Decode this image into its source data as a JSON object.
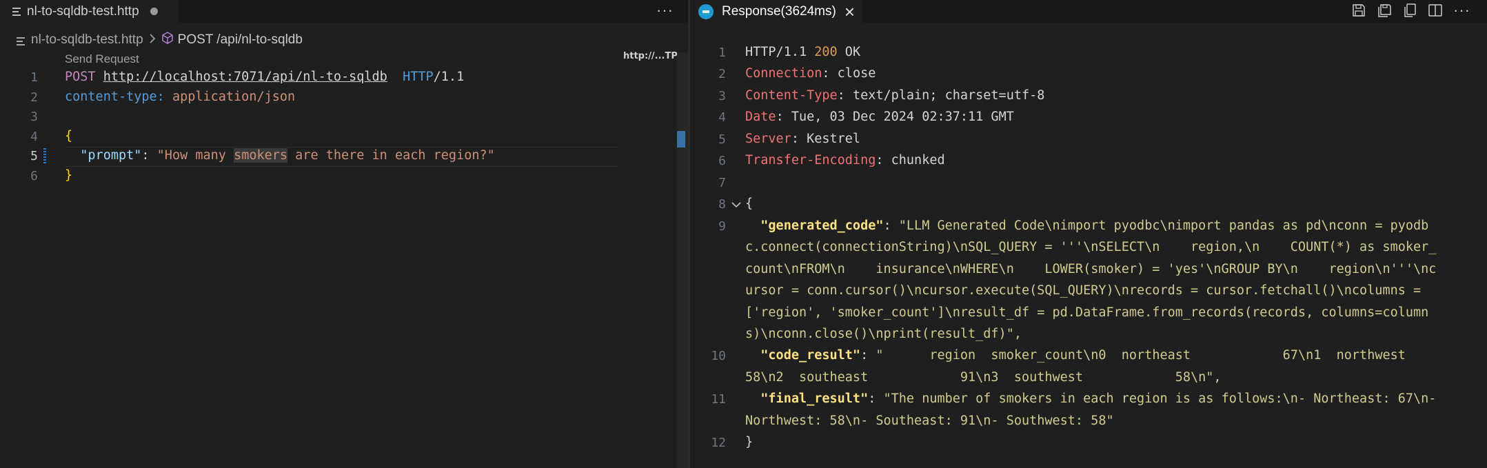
{
  "left": {
    "tab": {
      "title": "nl-to-sqldb-test.http"
    },
    "more_label": "···",
    "breadcrumb": {
      "file": "nl-to-sqldb-test.http",
      "request": "POST /api/nl-to-sqldb"
    },
    "codelens": "Send Request",
    "minimap_text": "http://...TP",
    "line_numbers": [
      "1",
      "2",
      "3",
      "4",
      "5",
      "6"
    ],
    "lines": {
      "l1": {
        "method": "POST",
        "url": "http://localhost:7071/api/nl-to-sqldb",
        "http": "HTTP",
        "version": "/1.1"
      },
      "l2": {
        "name": "content-type:",
        "value": "application/json"
      },
      "l4": {
        "brace": "{"
      },
      "l5": {
        "key": "\"prompt\"",
        "colon": ": ",
        "str_pre": "\"How many ",
        "str_hl": "smokers",
        "str_post": " are there in each region?\""
      },
      "l6": {
        "brace": "}"
      }
    }
  },
  "right": {
    "tab": {
      "title": "Response(3624ms)",
      "close": "×"
    },
    "more_label": "···",
    "line_numbers": [
      "1",
      "2",
      "3",
      "4",
      "5",
      "6",
      "7",
      "8",
      "9",
      "",
      "",
      "",
      "",
      "",
      "10",
      "",
      "11",
      "",
      "12"
    ],
    "status": {
      "proto": "HTTP/1.1 ",
      "code": "200",
      "text": " OK"
    },
    "headers": [
      {
        "name": "Connection",
        "value": "close"
      },
      {
        "name": "Content-Type",
        "value": "text/plain; charset=utf-8"
      },
      {
        "name": "Date",
        "value": "Tue, 03 Dec 2024 02:37:11 GMT"
      },
      {
        "name": "Server",
        "value": "Kestrel"
      },
      {
        "name": "Transfer-Encoding",
        "value": "chunked"
      }
    ],
    "json_open": "{",
    "json_close": "}",
    "generated_code": {
      "key": "\"generated_code\"",
      "rows": [
        "\"LLM Generated Code\\nimport pyodbc\\nimport pandas as pd\\nconn = pyodb",
        "c.connect(connectionString)\\nSQL_QUERY = '''\\nSELECT\\n    region,\\n    COUNT(*) as smoker_",
        "count\\nFROM\\n    insurance\\nWHERE\\n    LOWER(smoker) = 'yes'\\nGROUP BY\\n    region\\n'''\\nc",
        "ursor = conn.cursor()\\ncursor.execute(SQL_QUERY)\\nrecords = cursor.fetchall()\\ncolumns =",
        "['region', 'smoker_count']\\nresult_df = pd.DataFrame.from_records(records, columns=column",
        "s)\\nconn.close()\\nprint(result_df)\","
      ]
    },
    "code_result": {
      "key": "\"code_result\"",
      "rows": [
        "\"      region  smoker_count\\n0  northeast            67\\n1  northwest",
        "58\\n2  southeast            91\\n3  southwest            58\\n\","
      ]
    },
    "final_result": {
      "key": "\"final_result\"",
      "rows": [
        "\"The number of smokers in each region is as follows:\\n- Northeast: 67\\n-",
        "Northwest: 58\\n- Southeast: 91\\n- Southwest: 58\""
      ]
    }
  },
  "colors": {
    "background": "#1f1f1f",
    "tabbar": "#181818",
    "accent": "#0078d4"
  }
}
